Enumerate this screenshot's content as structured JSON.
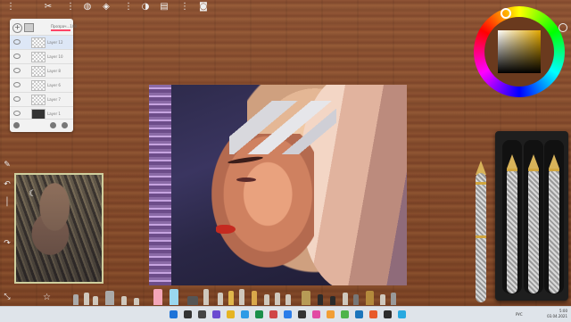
{
  "toolbar": {
    "icons": [
      "menu-dots-icon",
      "scissors-icon",
      "dots-icon",
      "globe-icon",
      "layers-icon",
      "dots-icon",
      "adjust-icon",
      "gallery-icon",
      "camera-icon"
    ]
  },
  "layers_panel": {
    "opacity_label": "Прозрач...100",
    "layers": [
      {
        "name": "Layer 12",
        "selected": true
      },
      {
        "name": "Layer 10",
        "selected": false
      },
      {
        "name": "Layer 8",
        "selected": false
      },
      {
        "name": "Layer 6",
        "selected": false
      },
      {
        "name": "Layer 7",
        "selected": false
      },
      {
        "name": "Layer 1",
        "selected": false
      }
    ]
  },
  "color_wheel": {
    "selected_color": "#e2a800"
  },
  "taskbar": {
    "language": "РУС",
    "time": "5:00",
    "date": "03.04.2021"
  },
  "colors": {
    "accent": "#f44d6e",
    "taskbar_bg": "#dfe4ea"
  }
}
